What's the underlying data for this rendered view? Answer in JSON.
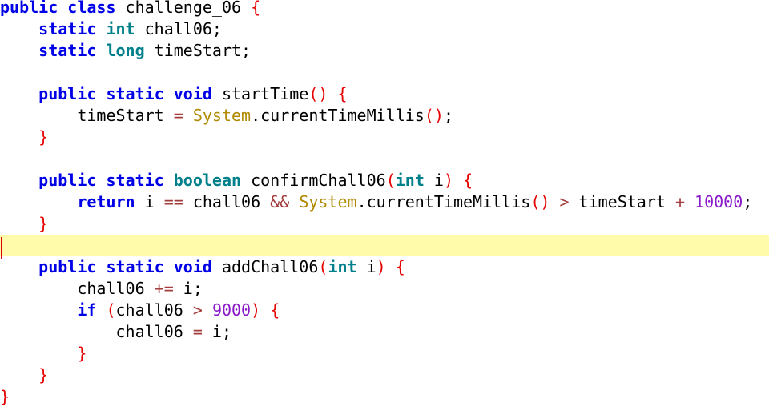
{
  "editor": {
    "highlight_color": "#fffbaa",
    "caret_color": "#e00000",
    "token_colors": {
      "keyword": "#0000e6",
      "type": "#00808a",
      "brace_paren": "#e60000",
      "operator": "#a33c3c",
      "number": "#8a1ac8",
      "class_name": "#b08a00",
      "identifier": "#000000"
    },
    "lines": [
      [
        {
          "t": "public",
          "k": "kw"
        },
        {
          "t": " ",
          "k": "id"
        },
        {
          "t": "class",
          "k": "kw"
        },
        {
          "t": " challenge_06 ",
          "k": "id"
        },
        {
          "t": "{",
          "k": "punct"
        }
      ],
      [
        {
          "t": "    ",
          "k": "id"
        },
        {
          "t": "static",
          "k": "kw"
        },
        {
          "t": " ",
          "k": "id"
        },
        {
          "t": "int",
          "k": "type"
        },
        {
          "t": " chall06;",
          "k": "id"
        }
      ],
      [
        {
          "t": "    ",
          "k": "id"
        },
        {
          "t": "static",
          "k": "kw"
        },
        {
          "t": " ",
          "k": "id"
        },
        {
          "t": "long",
          "k": "type"
        },
        {
          "t": " timeStart;",
          "k": "id"
        }
      ],
      [],
      [
        {
          "t": "    ",
          "k": "id"
        },
        {
          "t": "public",
          "k": "kw"
        },
        {
          "t": " ",
          "k": "id"
        },
        {
          "t": "static",
          "k": "kw"
        },
        {
          "t": " ",
          "k": "id"
        },
        {
          "t": "void",
          "k": "kw"
        },
        {
          "t": " startTime",
          "k": "id"
        },
        {
          "t": "()",
          "k": "punct"
        },
        {
          "t": " ",
          "k": "id"
        },
        {
          "t": "{",
          "k": "punct"
        }
      ],
      [
        {
          "t": "        timeStart ",
          "k": "id"
        },
        {
          "t": "=",
          "k": "op"
        },
        {
          "t": " ",
          "k": "id"
        },
        {
          "t": "System",
          "k": "cls"
        },
        {
          "t": ".currentTimeMillis",
          "k": "id"
        },
        {
          "t": "()",
          "k": "punct"
        },
        {
          "t": ";",
          "k": "id"
        }
      ],
      [
        {
          "t": "    ",
          "k": "id"
        },
        {
          "t": "}",
          "k": "punct"
        }
      ],
      [],
      [
        {
          "t": "    ",
          "k": "id"
        },
        {
          "t": "public",
          "k": "kw"
        },
        {
          "t": " ",
          "k": "id"
        },
        {
          "t": "static",
          "k": "kw"
        },
        {
          "t": " ",
          "k": "id"
        },
        {
          "t": "boolean",
          "k": "type"
        },
        {
          "t": " confirmChall06",
          "k": "id"
        },
        {
          "t": "(",
          "k": "punct"
        },
        {
          "t": "int",
          "k": "type"
        },
        {
          "t": " i",
          "k": "id"
        },
        {
          "t": ")",
          "k": "punct"
        },
        {
          "t": " ",
          "k": "id"
        },
        {
          "t": "{",
          "k": "punct"
        }
      ],
      [
        {
          "t": "        ",
          "k": "id"
        },
        {
          "t": "return",
          "k": "kw"
        },
        {
          "t": " i ",
          "k": "id"
        },
        {
          "t": "==",
          "k": "op"
        },
        {
          "t": " chall06 ",
          "k": "id"
        },
        {
          "t": "&&",
          "k": "op"
        },
        {
          "t": " ",
          "k": "id"
        },
        {
          "t": "System",
          "k": "cls"
        },
        {
          "t": ".currentTimeMillis",
          "k": "id"
        },
        {
          "t": "()",
          "k": "punct"
        },
        {
          "t": " ",
          "k": "id"
        },
        {
          "t": ">",
          "k": "op"
        },
        {
          "t": " timeStart ",
          "k": "id"
        },
        {
          "t": "+",
          "k": "op"
        },
        {
          "t": " ",
          "k": "id"
        },
        {
          "t": "10000",
          "k": "num"
        },
        {
          "t": ";",
          "k": "id"
        }
      ],
      [
        {
          "t": "    ",
          "k": "id"
        },
        {
          "t": "}",
          "k": "punct"
        }
      ],
      [],
      [
        {
          "t": "    ",
          "k": "id"
        },
        {
          "t": "public",
          "k": "kw"
        },
        {
          "t": " ",
          "k": "id"
        },
        {
          "t": "static",
          "k": "kw"
        },
        {
          "t": " ",
          "k": "id"
        },
        {
          "t": "void",
          "k": "kw"
        },
        {
          "t": " addChall06",
          "k": "id"
        },
        {
          "t": "(",
          "k": "punct"
        },
        {
          "t": "int",
          "k": "type"
        },
        {
          "t": " i",
          "k": "id"
        },
        {
          "t": ")",
          "k": "punct"
        },
        {
          "t": " ",
          "k": "id"
        },
        {
          "t": "{",
          "k": "punct"
        }
      ],
      [
        {
          "t": "        chall06 ",
          "k": "id"
        },
        {
          "t": "+=",
          "k": "op"
        },
        {
          "t": " i;",
          "k": "id"
        }
      ],
      [
        {
          "t": "        ",
          "k": "id"
        },
        {
          "t": "if",
          "k": "kw"
        },
        {
          "t": " ",
          "k": "id"
        },
        {
          "t": "(",
          "k": "punct"
        },
        {
          "t": "chall06 ",
          "k": "id"
        },
        {
          "t": ">",
          "k": "op"
        },
        {
          "t": " ",
          "k": "id"
        },
        {
          "t": "9000",
          "k": "num"
        },
        {
          "t": ")",
          "k": "punct"
        },
        {
          "t": " ",
          "k": "id"
        },
        {
          "t": "{",
          "k": "punct"
        }
      ],
      [
        {
          "t": "            chall06 ",
          "k": "id"
        },
        {
          "t": "=",
          "k": "op"
        },
        {
          "t": " i;",
          "k": "id"
        }
      ],
      [
        {
          "t": "        ",
          "k": "id"
        },
        {
          "t": "}",
          "k": "punct"
        }
      ],
      [
        {
          "t": "    ",
          "k": "id"
        },
        {
          "t": "}",
          "k": "punct"
        }
      ],
      [
        {
          "t": "}",
          "k": "punct"
        }
      ]
    ],
    "current_line_index": 11
  }
}
